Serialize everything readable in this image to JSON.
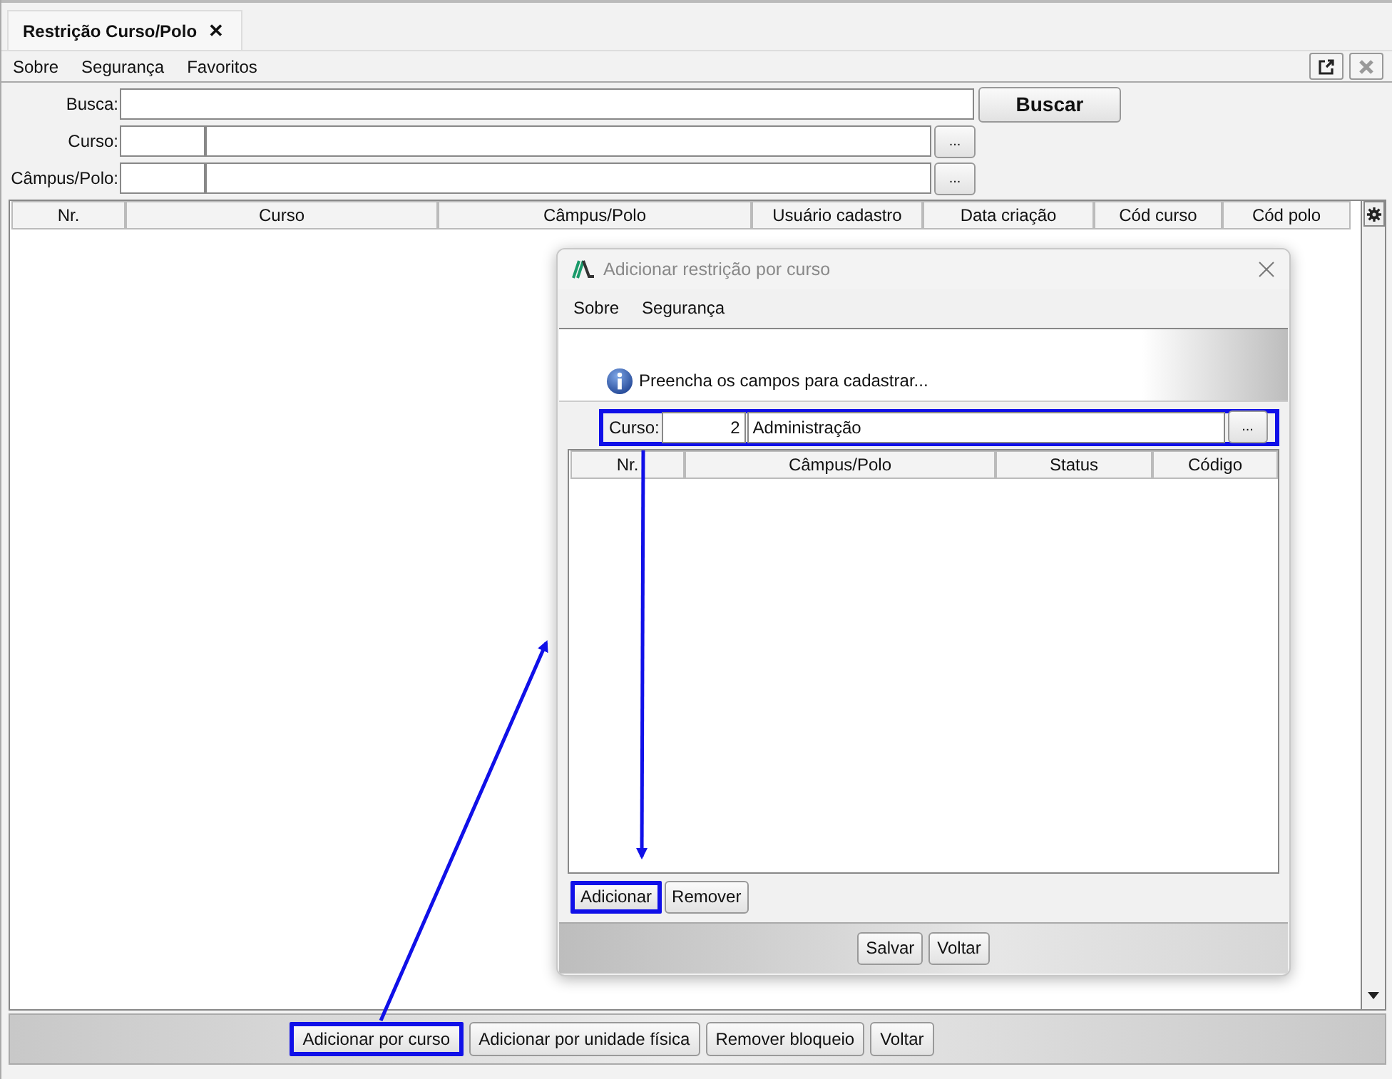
{
  "tab": {
    "label": "Restrição Curso/Polo",
    "close": "✕"
  },
  "menu": [
    "Sobre",
    "Segurança",
    "Favoritos"
  ],
  "filters": [
    {
      "kind": "search",
      "label": "Busca:",
      "button": "Buscar"
    },
    {
      "kind": "lookup",
      "label": "Curso:",
      "button": "..."
    },
    {
      "kind": "lookup",
      "label": "Câmpus/Polo:",
      "button": "..."
    }
  ],
  "table": {
    "columns": [
      "Nr.",
      "Curso",
      "Câmpus/Polo",
      "Usuário cadastro",
      "Data criação",
      "Cód curso",
      "Cód polo"
    ]
  },
  "actions": [
    {
      "label": "Adicionar por curso",
      "highlighted": true
    },
    {
      "label": "Adicionar por unidade física",
      "highlighted": false
    },
    {
      "label": "Remover bloqueio",
      "highlighted": false
    },
    {
      "label": "Voltar",
      "highlighted": false
    }
  ],
  "dialog": {
    "title": "Adicionar restrição por curso",
    "menu": [
      "Sobre",
      "Segurança"
    ],
    "message": "Preencha os campos para cadastrar...",
    "course": {
      "label": "Curso:",
      "code": "2",
      "name": "Administração",
      "button": "...",
      "highlighted": true
    },
    "table": {
      "columns": [
        "Nr.",
        "Câmpus/Polo",
        "Status",
        "Código"
      ]
    },
    "row_buttons": [
      {
        "label": "Adicionar",
        "highlighted": true
      },
      {
        "label": "Remover",
        "highlighted": false
      }
    ],
    "footer_buttons": [
      "Salvar",
      "Voltar"
    ]
  }
}
